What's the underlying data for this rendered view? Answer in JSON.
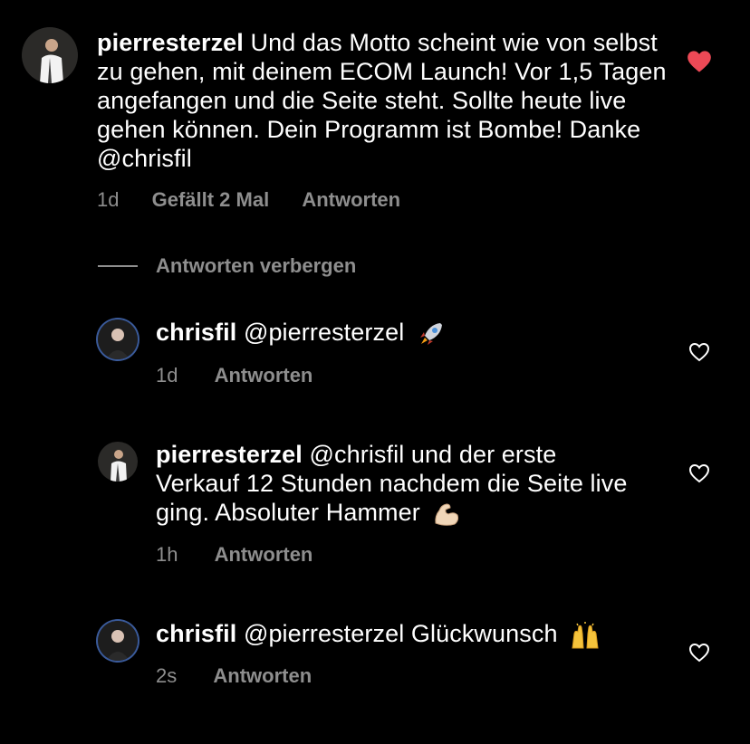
{
  "comments": [
    {
      "username": "pierresterzel",
      "text": "Und das Motto scheint wie von selbst zu gehen, mit deinem ECOM Launch! Vor 1,5 Tagen angefangen und die Seite steht. Sollte heute live gehen können. Dein Programm ist Bombe! Danke @chrisfil",
      "time": "1d",
      "likes": "Gefällt 2 Mal",
      "reply": "Antworten",
      "liked": true
    }
  ],
  "hide_replies_label": "Antworten verbergen",
  "replies": [
    {
      "username": "chrisfil",
      "text": "@pierresterzel",
      "emoji": "rocket",
      "time": "1d",
      "reply": "Antworten"
    },
    {
      "username": "pierresterzel",
      "text": "@chrisfil und der erste Verkauf 12 Stunden nachdem die Seite live ging. Absoluter Hammer",
      "emoji": "flexed-biceps",
      "time": "1h",
      "reply": "Antworten"
    },
    {
      "username": "chrisfil",
      "text": "@pierresterzel Glückwunsch",
      "emoji": "raising-hands",
      "time": "2s",
      "reply": "Antworten"
    }
  ],
  "colors": {
    "background": "#000000",
    "text": "#ffffff",
    "muted": "#8e8e8e",
    "liked_heart": "#ed4956"
  }
}
